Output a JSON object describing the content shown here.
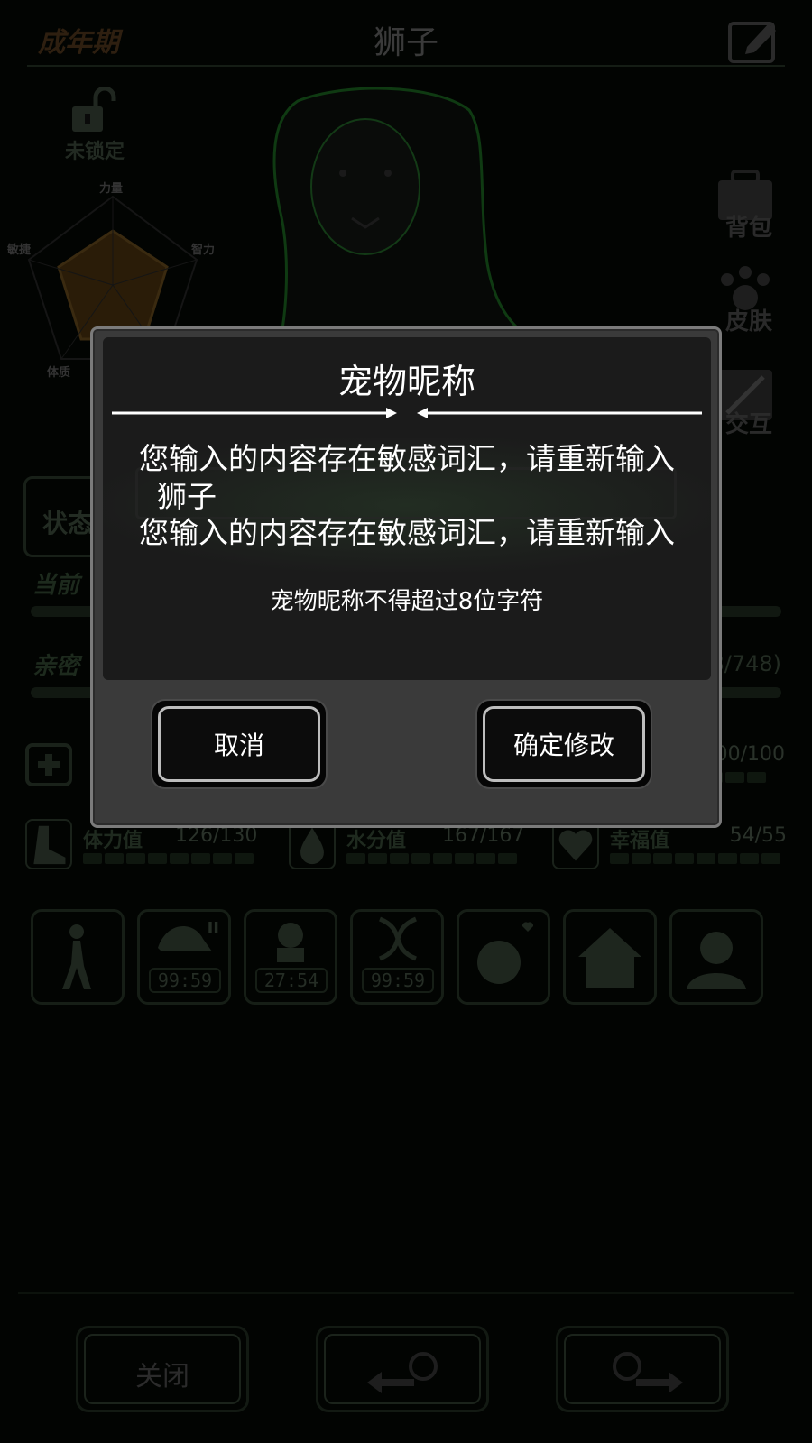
{
  "header": {
    "stage": "成年期",
    "pet_name": "狮子"
  },
  "lock": {
    "label": "未锁定"
  },
  "radar": {
    "labels": [
      "力量",
      "智力",
      "体质",
      "敏捷"
    ]
  },
  "side_buttons": [
    "背包",
    "皮肤",
    "交互"
  ],
  "status_tab": {
    "label": "状态"
  },
  "bars": {
    "current_label": "当前",
    "intimacy_label": "亲密",
    "intimacy_value": "8/748)"
  },
  "stats_row1": {
    "health_value": "00/100"
  },
  "stats_row2": [
    {
      "name": "体力值",
      "value": "126/130"
    },
    {
      "name": "水分值",
      "value": "167/167"
    },
    {
      "name": "幸福值",
      "value": "54/55"
    }
  ],
  "skills": {
    "timers": [
      "99:59",
      "27:54",
      "99:59"
    ],
    "badge": "II"
  },
  "bottom": {
    "close_label": "关闭"
  },
  "modal": {
    "title": "宠物昵称",
    "error_line1": "您输入的内容存在敏感词汇，请重新输入",
    "input_value": "狮子",
    "error_line2": "您输入的内容存在敏感词汇，请重新输入",
    "hint": "宠物昵称不得超过8位字符",
    "cancel_label": "取消",
    "confirm_label": "确定修改"
  },
  "colors": {
    "overlay_bg": "#020402",
    "modal_frame": "#3a3a3a",
    "modal_panel": "#1b1b1b",
    "button_border": "#bdbdbd"
  }
}
